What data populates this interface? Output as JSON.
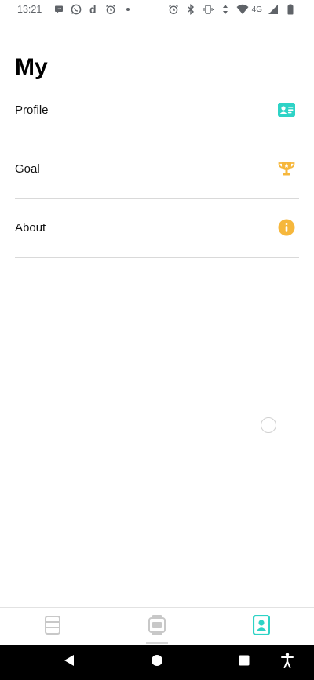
{
  "status_bar": {
    "time": "13:21",
    "left_icons": [
      "message-icon",
      "whatsapp-icon",
      "d-app-icon",
      "alarm-icon",
      "dot-icon"
    ],
    "right_icons": [
      "alarm-icon",
      "bluetooth-icon",
      "vibrate-icon",
      "data-arrows-icon",
      "wifi-icon",
      "signal-icon",
      "battery-icon"
    ],
    "network": "4G",
    "d_app_letter": "d"
  },
  "page": {
    "title": "My"
  },
  "menu": {
    "items": [
      {
        "label": "Profile",
        "icon": "profile-card-icon",
        "icon_color": "#2ed3c6"
      },
      {
        "label": "Goal",
        "icon": "trophy-icon",
        "icon_color": "#f6b73c"
      },
      {
        "label": "About",
        "icon": "info-icon",
        "icon_color": "#f6b73c"
      }
    ]
  },
  "tabs": [
    {
      "icon": "list-icon",
      "active": false
    },
    {
      "icon": "watch-icon",
      "active": false
    },
    {
      "icon": "person-icon",
      "active": true
    }
  ],
  "colors": {
    "accent": "#2ed3c6",
    "warning": "#f6b73c",
    "inactive": "#c8c8c8",
    "divider": "#d9d9d9"
  }
}
